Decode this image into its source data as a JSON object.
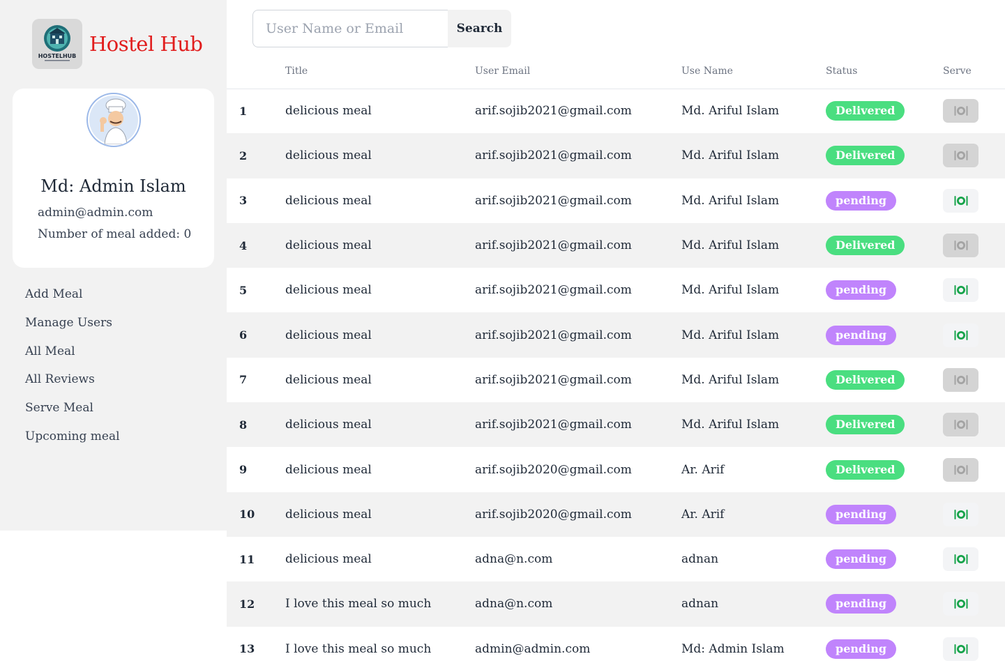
{
  "brand": {
    "name": "Hostel Hub",
    "logo_text": "HOSTELHUB"
  },
  "profile": {
    "name": "Md: Admin Islam",
    "email": "admin@admin.com",
    "meal_count_text": "Number of meal added: 0"
  },
  "nav": [
    {
      "label": "Add Meal"
    },
    {
      "label": "Manage Users"
    },
    {
      "label": "All Meal"
    },
    {
      "label": "All Reviews"
    },
    {
      "label": "Serve Meal"
    },
    {
      "label": "Upcoming meal"
    }
  ],
  "search": {
    "placeholder": "User Name or Email",
    "button_label": "Search"
  },
  "table": {
    "headers": [
      "",
      "Title",
      "User Email",
      "Use Name",
      "Status",
      "Serve"
    ],
    "rows": [
      {
        "num": "1",
        "title": "delicious meal",
        "email": "arif.sojib2021@gmail.com",
        "name": "Md. Ariful Islam",
        "status": "Delivered"
      },
      {
        "num": "2",
        "title": "delicious meal",
        "email": "arif.sojib2021@gmail.com",
        "name": "Md. Ariful Islam",
        "status": "Delivered"
      },
      {
        "num": "3",
        "title": "delicious meal",
        "email": "arif.sojib2021@gmail.com",
        "name": "Md. Ariful Islam",
        "status": "pending"
      },
      {
        "num": "4",
        "title": "delicious meal",
        "email": "arif.sojib2021@gmail.com",
        "name": "Md. Ariful Islam",
        "status": "Delivered"
      },
      {
        "num": "5",
        "title": "delicious meal",
        "email": "arif.sojib2021@gmail.com",
        "name": "Md. Ariful Islam",
        "status": "pending"
      },
      {
        "num": "6",
        "title": "delicious meal",
        "email": "arif.sojib2021@gmail.com",
        "name": "Md. Ariful Islam",
        "status": "pending"
      },
      {
        "num": "7",
        "title": "delicious meal",
        "email": "arif.sojib2021@gmail.com",
        "name": "Md. Ariful Islam",
        "status": "Delivered"
      },
      {
        "num": "8",
        "title": "delicious meal",
        "email": "arif.sojib2021@gmail.com",
        "name": "Md. Ariful Islam",
        "status": "Delivered"
      },
      {
        "num": "9",
        "title": "delicious meal",
        "email": "arif.sojib2020@gmail.com",
        "name": "Ar. Arif",
        "status": "Delivered"
      },
      {
        "num": "10",
        "title": "delicious meal",
        "email": "arif.sojib2020@gmail.com",
        "name": "Ar. Arif",
        "status": "pending"
      },
      {
        "num": "11",
        "title": "delicious meal",
        "email": "adna@n.com",
        "name": "adnan",
        "status": "pending"
      },
      {
        "num": "12",
        "title": "I love this meal so much",
        "email": "adna@n.com",
        "name": "adnan",
        "status": "pending"
      },
      {
        "num": "13",
        "title": "I love this meal so much",
        "email": "admin@admin.com",
        "name": "Md: Admin Islam",
        "status": "pending"
      }
    ]
  },
  "colors": {
    "brand": "#e11d1d",
    "delivered": "#4ade80",
    "pending": "#c084fc",
    "serve_active_icon": "#16a34a",
    "serve_disabled_icon": "#a3a3a3"
  },
  "icons": {
    "serve": "serve-meal-icon",
    "avatar": "chef-avatar-icon",
    "logo": "hostel-logo-icon"
  }
}
